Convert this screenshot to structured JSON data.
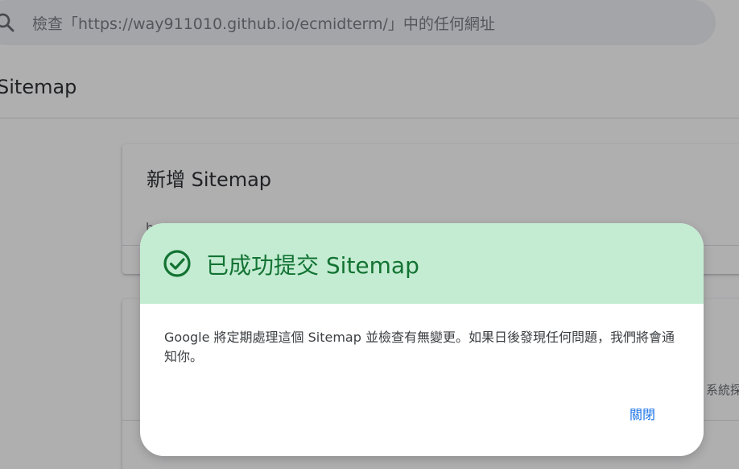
{
  "search": {
    "placeholder": "檢查「https://way911010.github.io/ecmidterm/」中的任何網址"
  },
  "page": {
    "title": "Sitemap"
  },
  "add_card": {
    "title": "新增 Sitemap",
    "fragment": "h"
  },
  "list_card": {
    "fragment": "系統探"
  },
  "dialog": {
    "title": "已成功提交 Sitemap",
    "message": "Google 將定期處理這個 Sitemap 並檢查有無變更。如果日後發現任何問題，我們將會通知你。",
    "close_label": "關閉"
  },
  "colors": {
    "success_header_bg": "#c4ecd2",
    "success_text": "#137333",
    "link_blue": "#1a73e8"
  },
  "icons": {
    "search": "search-icon",
    "success": "check-circle-icon"
  }
}
